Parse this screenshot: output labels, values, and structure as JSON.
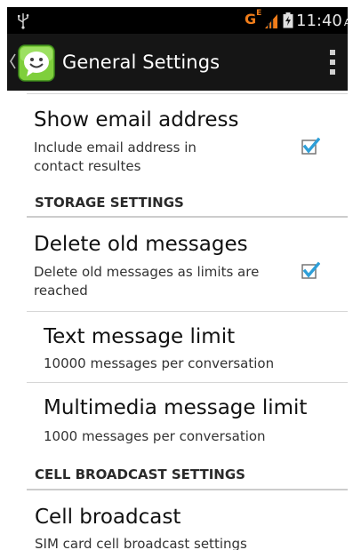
{
  "status_bar": {
    "network_type": "G",
    "network_sub": "E",
    "time": "11:40",
    "ampm": "AM"
  },
  "action_bar": {
    "title": "General Settings"
  },
  "settings": {
    "show_email": {
      "title": "Show email address",
      "summary": "Include email address in contact resultes",
      "checked": true
    },
    "storage_header": "STORAGE SETTINGS",
    "delete_old": {
      "title": "Delete old messages",
      "summary": "Delete old messages as limits are reached",
      "checked": true
    },
    "text_limit": {
      "title": "Text message limit",
      "summary": "10000 messages per conversation"
    },
    "mms_limit": {
      "title": "Multimedia message limit",
      "summary": "1000 messages per conversation"
    },
    "cell_broadcast_header": "CELL BROADCAST SETTINGS",
    "cell_broadcast": {
      "title": "Cell broadcast",
      "summary": "SIM card cell broadcast settings"
    }
  },
  "colors": {
    "accent_check": "#2e9fd8",
    "status_bar_bg": "#000000",
    "action_bar_bg": "#151515",
    "network_orange": "#f07d1a"
  }
}
